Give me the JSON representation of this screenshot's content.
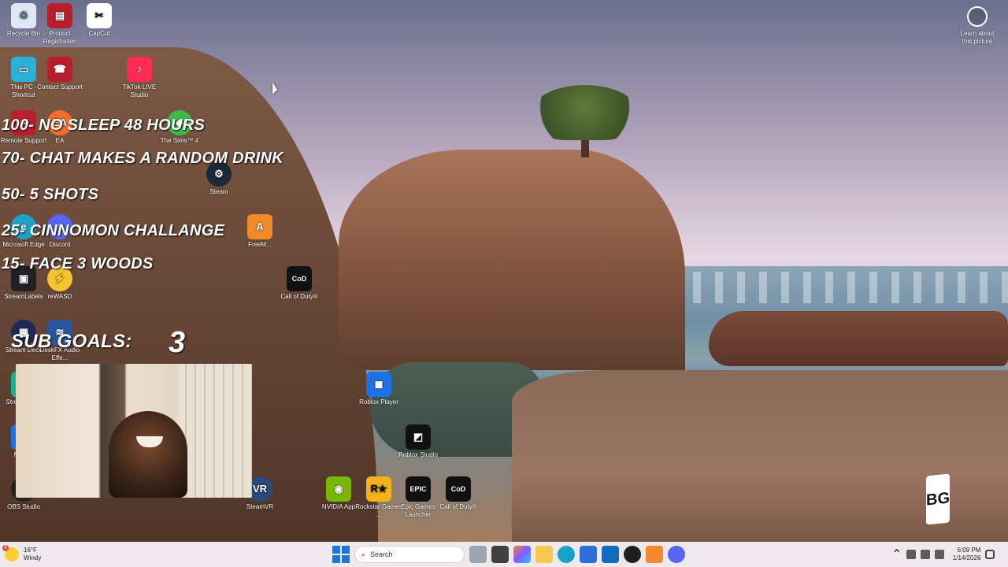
{
  "desktop": {
    "icons": [
      {
        "label": "Recycle Bin",
        "icon": "recycle-bin-icon",
        "color": "#dfe7f2"
      },
      {
        "label": "Product Registration",
        "icon": "product-registration-icon",
        "color": "#b81f2a"
      },
      {
        "label": "CapCut",
        "icon": "capcut-icon",
        "color": "#ffffff"
      },
      {
        "label": "This PC - Shortcut",
        "icon": "pc-icon",
        "color": "#2bb0d8"
      },
      {
        "label": "Contact Support",
        "icon": "support-icon",
        "color": "#b81f2a"
      },
      {
        "label": "TikTok LIVE Studio",
        "icon": "tiktok-icon",
        "color": "#fe2c55"
      },
      {
        "label": "Remote Support",
        "icon": "remote-support-icon",
        "color": "#b81f2a"
      },
      {
        "label": "EA",
        "icon": "ea-icon",
        "color": "#f56c2d"
      },
      {
        "label": "The Sims™ 4",
        "icon": "sims-icon",
        "color": "#3dbb4a"
      },
      {
        "label": "Steam",
        "icon": "steam-icon",
        "color": "#1b2838"
      },
      {
        "label": "FreeM...",
        "icon": "app-orange-icon",
        "color": "#f08a2b"
      },
      {
        "label": "Microsoft Edge",
        "icon": "edge-icon",
        "color": "#1ba3c4"
      },
      {
        "label": "Discord",
        "icon": "discord-icon",
        "color": "#5865f2"
      },
      {
        "label": "Call of Duty®",
        "icon": "cod-icon",
        "color": "#111111"
      },
      {
        "label": "StreamLabels",
        "icon": "streamlabels-icon",
        "color": "#202124"
      },
      {
        "label": "reWASD",
        "icon": "rewasd-icon",
        "color": "#f7c331"
      },
      {
        "label": "Stream Deck",
        "icon": "stream-deck-icon",
        "color": "#1e2a55"
      },
      {
        "label": "DeskFX Audio Effe...",
        "icon": "deskfx-icon",
        "color": "#2a56a0"
      },
      {
        "label": "Roblox Player",
        "icon": "roblox-icon",
        "color": "#1f6fe5"
      },
      {
        "label": "Roblox Studio",
        "icon": "roblox-studio-icon",
        "color": "#111111"
      },
      {
        "label": "OBS Studio",
        "icon": "obs-icon",
        "color": "#222222"
      },
      {
        "label": "SteamVR",
        "icon": "steamvr-icon",
        "color": "#2a4a7a"
      },
      {
        "label": "NVIDIA App",
        "icon": "nvidia-icon",
        "color": "#76b900"
      },
      {
        "label": "Rockstar Games ...",
        "icon": "rockstar-icon",
        "color": "#f6b21b"
      },
      {
        "label": "Epic Games Launcher",
        "icon": "epic-icon",
        "color": "#111111"
      },
      {
        "label": "Call of Duty®",
        "icon": "cod-icon-2",
        "color": "#111111"
      },
      {
        "label": "Strea... De...",
        "icon": "stream-app-icon",
        "color": "#14b38d"
      },
      {
        "label": "Meta...",
        "icon": "meta-icon",
        "color": "#1a73e8"
      }
    ],
    "learn_about": "Learn about this picture",
    "corner_logo": "BG"
  },
  "overlay": {
    "lines": [
      "100- NO SLEEP 48 HOURS",
      "70- CHAT MAKES A RANDOM DRINK",
      "50- 5 SHOTS",
      "25- CINNOMON CHALLANGE",
      "15- FACE 3 WOODS"
    ],
    "sub_goals_label": "SUB GOALS:",
    "sub_goals_count": "3"
  },
  "taskbar": {
    "weather_temp": "16°F",
    "weather_desc": "Windy",
    "weather_badge": "6",
    "search_placeholder": "Search",
    "time": "6:09 PM",
    "date": "1/14/2026",
    "apps": [
      "files-icon",
      "task-view-icon",
      "copilot-icon",
      "file-explorer-icon",
      "chrome-icon",
      "edge-taskbar-icon",
      "store-icon",
      "outlook-icon",
      "obs-taskbar-icon",
      "app-orange-taskbar-icon",
      "discord-taskbar-icon"
    ]
  }
}
